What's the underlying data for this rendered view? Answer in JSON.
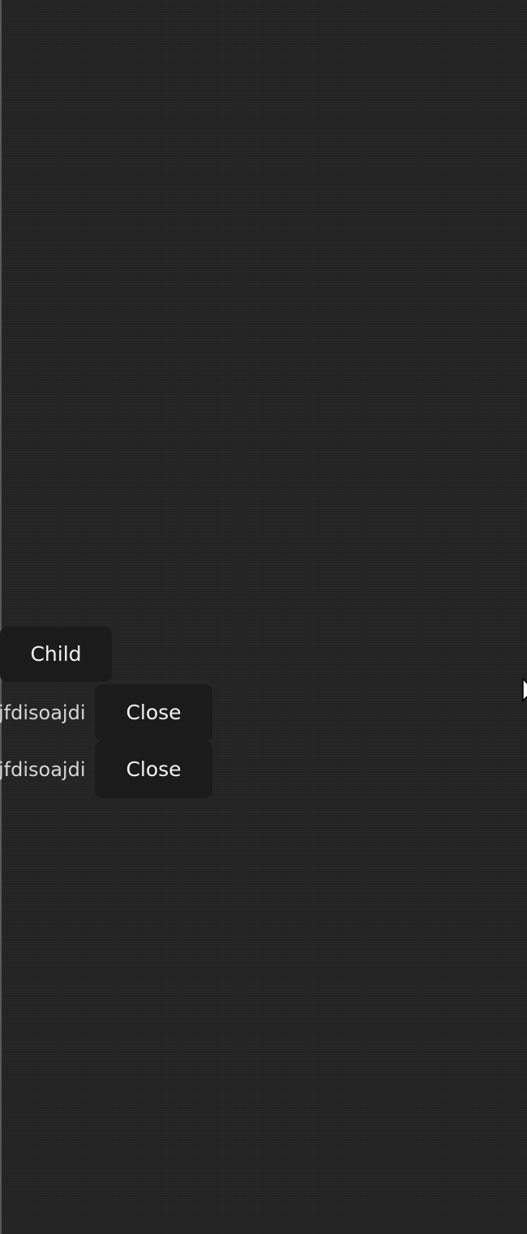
{
  "child_button": {
    "label": "Child"
  },
  "items": [
    {
      "text": "jfdisoajdi",
      "close_label": "Close"
    },
    {
      "text": "jfdisoajdi",
      "close_label": "Close"
    }
  ],
  "colors": {
    "background": "#242424",
    "button_bg": "#1b1b1b",
    "button_text": "#f2f2f2",
    "item_text": "#d6d6d6"
  },
  "icons": {
    "pointer": "mouse-pointer-icon"
  }
}
